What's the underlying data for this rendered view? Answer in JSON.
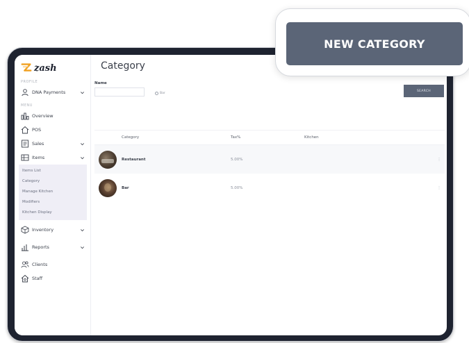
{
  "app": {
    "logo_text": "zash",
    "brand_color": "#f0a020"
  },
  "sidebar": {
    "section_profile": "PROFILE",
    "profile_item": "DNA Payments",
    "section_menu": "MENU",
    "items": [
      {
        "label": "Overview",
        "icon": "chart-icon",
        "expandable": false
      },
      {
        "label": "POS",
        "icon": "home-icon",
        "expandable": false
      },
      {
        "label": "Sales",
        "icon": "document-icon",
        "expandable": true
      },
      {
        "label": "Items",
        "icon": "grid-icon",
        "expandable": true
      }
    ],
    "items_subnav": [
      "Items List",
      "Category",
      "Manage Kitchen",
      "Modifiers",
      "Kitchen Display"
    ],
    "items_after": [
      {
        "label": "Inventory",
        "icon": "box-icon",
        "expandable": true
      },
      {
        "label": "Reports",
        "icon": "bar-chart-icon",
        "expandable": true
      },
      {
        "label": "Clients",
        "icon": "users-icon",
        "expandable": false
      },
      {
        "label": "Staff",
        "icon": "staff-icon",
        "expandable": false
      }
    ]
  },
  "main": {
    "title": "Category",
    "filter": {
      "name_label": "Name",
      "name_value": "",
      "radio_label": "Bar"
    },
    "search_button": "SEARCH",
    "table": {
      "headers": [
        "Category",
        "Tax%",
        "Kitchen"
      ],
      "rows": [
        {
          "category": "Restaurant",
          "tax": "5.00%",
          "kitchen": ""
        },
        {
          "category": "Bar",
          "tax": "5.00%",
          "kitchen": ""
        }
      ]
    }
  },
  "callout": {
    "button_label": "NEW CATEGORY"
  },
  "colors": {
    "frame": "#1e2330",
    "button": "#5b6577"
  }
}
